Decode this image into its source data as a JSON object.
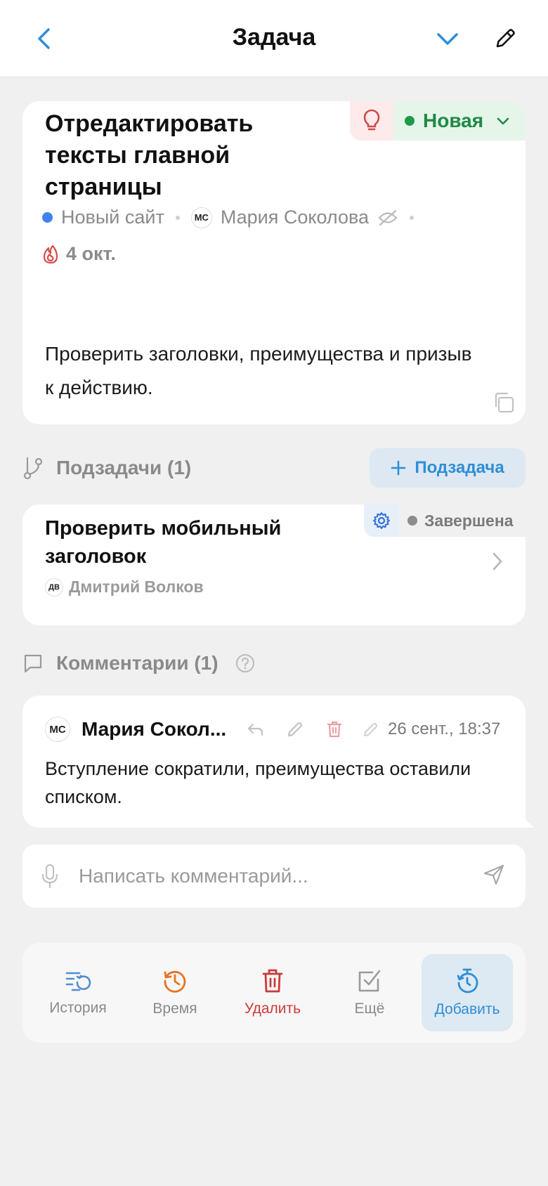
{
  "header": {
    "title": "Задача",
    "back_icon": "chevron-left-icon",
    "collapse_icon": "chevron-down-icon",
    "edit_icon": "pencil-icon"
  },
  "task": {
    "title": "Отредактировать тексты главной страницы",
    "status": "Новая",
    "status_color": "#1f9a4b",
    "project": "Новый сайт",
    "project_color": "#3f82f0",
    "assignee": "Мария Соколова",
    "assignee_initials": "МС",
    "due_date": "4 окт.",
    "description": "Проверить заголовки, преимущества и призыв к действию."
  },
  "subtasks": {
    "header": "Подзадачи (1)",
    "add_label": "Подзадача",
    "items": [
      {
        "title": "Проверить мобильный заголовок",
        "status": "Завершена",
        "assignee": "Дмитрий Волков",
        "assignee_initials": "ДВ"
      }
    ]
  },
  "comments": {
    "header": "Комментарии (1)",
    "items": [
      {
        "author": "Мария Сокол...",
        "author_initials": "МС",
        "date": "26 сент., 18:37",
        "text": "Вступление сократили, преимущества оставили списком."
      }
    ]
  },
  "comment_input": {
    "placeholder": "Написать комментарий..."
  },
  "toolbar": {
    "history": "История",
    "time": "Время",
    "delete": "Удалить",
    "more": "Ещё",
    "add": "Добавить"
  },
  "colors": {
    "accent": "#2f8ed6",
    "danger": "#cc3b3b",
    "orange": "#e8731f",
    "status_done": "#8c8c8c"
  }
}
